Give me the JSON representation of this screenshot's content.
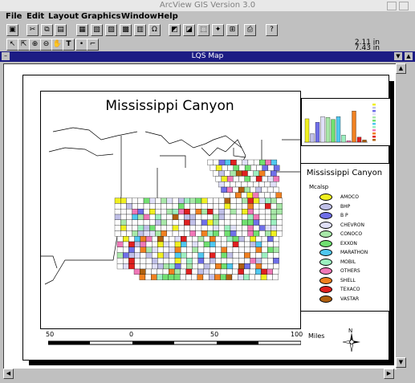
{
  "window": {
    "title": "ArcView GIS Version 3.0"
  },
  "menu": [
    "File",
    "Edit",
    "Layout",
    "Graphics",
    "Window",
    "Help"
  ],
  "toolbar_icons": [
    "save-icon",
    "cut-icon",
    "copy-icon",
    "paste-icon",
    "layout-icon",
    "frame-icon",
    "chart-frame-icon",
    "legend-frame-icon",
    "scale-frame-icon",
    "north-arrow-icon",
    "picture-frame-icon",
    "template-icon",
    "print-icon",
    "help-icon"
  ],
  "readout": {
    "x": "2.11 in",
    "y": "7.43 in"
  },
  "document": {
    "title": "LQS Map"
  },
  "map": {
    "title": "Mississippi Canyon"
  },
  "legend": {
    "title": "Mississippi Canyon",
    "subtitle": "Mcalsp",
    "items": [
      {
        "label": "AMOCO",
        "color": "#f0f020"
      },
      {
        "label": "BHP",
        "color": "#c0c0e8"
      },
      {
        "label": "B P",
        "color": "#6f6fe8"
      },
      {
        "label": "CHEVRON",
        "color": "#e0e0f8"
      },
      {
        "label": "CONOCO",
        "color": "#a8e8a8"
      },
      {
        "label": "EXXON",
        "color": "#70e070"
      },
      {
        "label": "MARATHON",
        "color": "#50c8f0"
      },
      {
        "label": "MOBIL",
        "color": "#9cf0c0"
      },
      {
        "label": "OTHERS",
        "color": "#f078b8"
      },
      {
        "label": "SHELL",
        "color": "#f08020"
      },
      {
        "label": "TEXACO",
        "color": "#e02020"
      },
      {
        "label": "VASTAR",
        "color": "#b06010"
      }
    ]
  },
  "chart_data": {
    "type": "bar",
    "title": "",
    "categories": [
      "AMOCO",
      "BHP",
      "B P",
      "CHEVRON",
      "CONOCO",
      "EXXON",
      "MARATHON",
      "MOBIL",
      "OTHERS",
      "SHELL",
      "TEXACO",
      "VASTAR"
    ],
    "values": [
      33,
      12,
      28,
      36,
      35,
      32,
      36,
      10,
      2,
      44,
      7,
      3
    ]
  },
  "scalebar": {
    "labels": [
      "50",
      "0",
      "50",
      "100"
    ],
    "unit": "Miles"
  },
  "north": {
    "label": "N"
  }
}
